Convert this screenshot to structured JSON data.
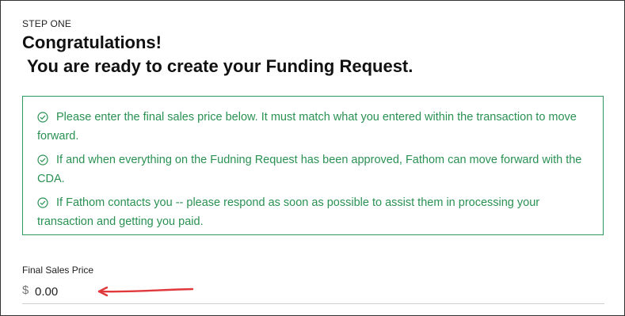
{
  "step": {
    "label": "STEP ONE"
  },
  "headline": {
    "line1": "Congratulations!",
    "line2": "You are ready to create your Funding Request."
  },
  "info": {
    "items": [
      {
        "icon": "check-circle-icon",
        "text": "Please enter the final sales price below. It must match what you entered within the transaction to move forward."
      },
      {
        "icon": "check-circle-icon",
        "text": "If and when everything on the Fudning Request has been approved, Fathom can move forward with the CDA."
      },
      {
        "icon": "check-circle-icon",
        "text": "If Fathom contacts you -- please respond as soon as possible to assist them in processing your transaction and getting you paid."
      }
    ]
  },
  "final_sales_price": {
    "label": "Final Sales Price",
    "currency_symbol": "$",
    "value": "0.00"
  },
  "colors": {
    "accent_green": "#2a9153",
    "arrow_red": "#e0383b"
  }
}
